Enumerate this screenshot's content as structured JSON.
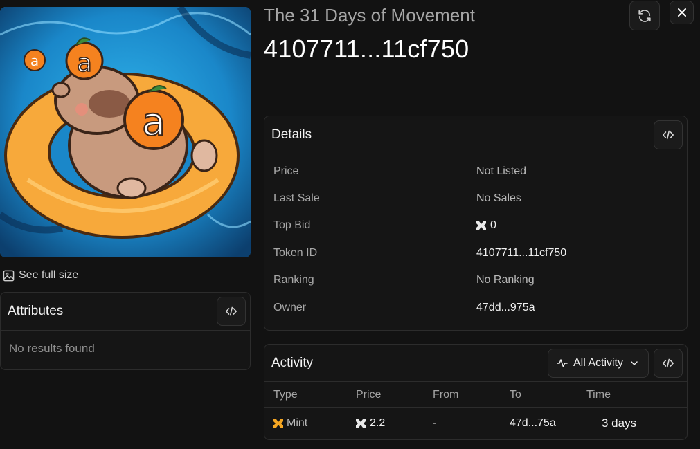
{
  "collection_name": "The 31 Days of Movement",
  "token_title": "4107711...11cf750",
  "image_link": {
    "label": "See full size",
    "icon": "image-icon"
  },
  "attributes": {
    "title": "Attributes",
    "empty_text": "No results found",
    "code_icon": "code-icon"
  },
  "details": {
    "title": "Details",
    "rows": [
      {
        "label": "Price",
        "value": "Not Listed"
      },
      {
        "label": "Last Sale",
        "value": "No Sales"
      },
      {
        "label": "Top Bid",
        "value": "0"
      },
      {
        "label": "Token ID",
        "value": "4107711...11cf750"
      },
      {
        "label": "Ranking",
        "value": "No Ranking"
      },
      {
        "label": "Owner",
        "value": "47dd...975a"
      }
    ]
  },
  "activity": {
    "title": "Activity",
    "filter_label": "All Activity",
    "columns": [
      "Type",
      "Price",
      "From",
      "To",
      "Time"
    ],
    "rows": [
      {
        "type": "Mint",
        "price": "2.2",
        "from": "-",
        "to": "47d...75a",
        "time": "3 days"
      }
    ]
  },
  "colors": {
    "background": "#121212",
    "accent_orange": "#f5a623",
    "ring_orange": "#f7a93b"
  }
}
